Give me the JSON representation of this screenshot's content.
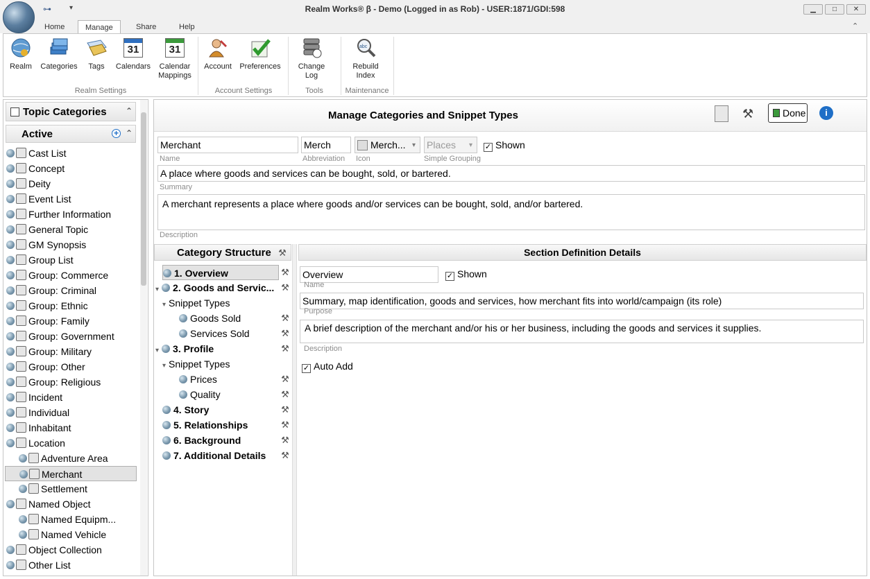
{
  "window": {
    "title": "Realm Works® β - Demo (Logged in as Rob) - USER:1871/GDI:598",
    "minimize": "▁",
    "maximize": "□",
    "close": "✕"
  },
  "ribbon_tabs": [
    "Home",
    "Manage",
    "Share",
    "Help"
  ],
  "ribbon": {
    "buttons": {
      "realm": "Realm",
      "categories": "Categories",
      "tags": "Tags",
      "calendars": "Calendars",
      "calendar_mappings_1": "Calendar",
      "calendar_mappings_2": "Mappings",
      "account": "Account",
      "preferences": "Preferences",
      "change_log_1": "Change",
      "change_log_2": "Log",
      "rebuild_index_1": "Rebuild",
      "rebuild_index_2": "Index"
    },
    "groups": {
      "realm_settings": "Realm Settings",
      "account_settings": "Account Settings",
      "tools": "Tools",
      "maintenance": "Maintenance"
    },
    "calendar_day": "31"
  },
  "left": {
    "header": "Topic Categories",
    "section": "Active",
    "items": [
      {
        "label": "Cast List"
      },
      {
        "label": "Concept"
      },
      {
        "label": "Deity"
      },
      {
        "label": "Event List"
      },
      {
        "label": "Further Information"
      },
      {
        "label": "General Topic"
      },
      {
        "label": "GM Synopsis"
      },
      {
        "label": "Group List"
      },
      {
        "label": "Group: Commerce"
      },
      {
        "label": "Group: Criminal"
      },
      {
        "label": "Group: Ethnic"
      },
      {
        "label": "Group: Family"
      },
      {
        "label": "Group: Government"
      },
      {
        "label": "Group: Military"
      },
      {
        "label": "Group: Other"
      },
      {
        "label": "Group: Religious"
      },
      {
        "label": "Incident"
      },
      {
        "label": "Individual"
      },
      {
        "label": "Inhabitant"
      },
      {
        "label": "Location"
      },
      {
        "label": "Adventure Area"
      },
      {
        "label": "Merchant"
      },
      {
        "label": "Settlement"
      },
      {
        "label": "Named Object"
      },
      {
        "label": "Named Equipm..."
      },
      {
        "label": "Named Vehicle"
      },
      {
        "label": "Object Collection"
      },
      {
        "label": "Other List"
      }
    ]
  },
  "main": {
    "title": "Manage Categories and Snippet Types",
    "done_label": "Done",
    "info_glyph": "i",
    "name_value": "Merchant",
    "name_caption": "Name",
    "abbreviation_value": "Merch",
    "abbreviation_caption": "Abbreviation",
    "icon_value": "Merch...",
    "icon_caption": "Icon",
    "grouping_value": "Places",
    "grouping_caption": "Simple Grouping",
    "shown_label": "Shown",
    "summary_value": "A place where goods and services can be bought, sold, or bartered.",
    "summary_caption": "Summary",
    "description_value": "A merchant represents a place where goods and/or services can be bought, sold, and/or bartered.",
    "description_caption": "Description"
  },
  "structure": {
    "header": "Category Structure",
    "items": [
      {
        "label": "1. Overview"
      },
      {
        "label": "2. Goods and Servic..."
      },
      {
        "label": "Snippet Types"
      },
      {
        "label": "Goods Sold"
      },
      {
        "label": "Services Sold"
      },
      {
        "label": "3. Profile"
      },
      {
        "label": "Snippet Types"
      },
      {
        "label": "Prices"
      },
      {
        "label": "Quality"
      },
      {
        "label": "4. Story"
      },
      {
        "label": "5. Relationships"
      },
      {
        "label": "6. Background"
      },
      {
        "label": "7. Additional Details"
      }
    ]
  },
  "section_details": {
    "header": "Section Definition Details",
    "name_value": "Overview",
    "name_caption": "Name",
    "shown_label": "Shown",
    "purpose_value": "Summary, map identification, goods and services, how merchant fits into world/campaign (its role)",
    "purpose_caption": "Purpose",
    "description_value": "A brief description of the merchant and/or his or her business, including the goods and services it supplies.",
    "description_caption": "Description",
    "auto_add_label": "Auto Add"
  },
  "glyphs": {
    "check": "✓",
    "collapse": "⌃",
    "expand_tri": "▾",
    "wrench": "⚒",
    "add": "+"
  },
  "colors": {
    "accent": "#1f6fc7",
    "selected_bg": "#e3e3e3"
  }
}
